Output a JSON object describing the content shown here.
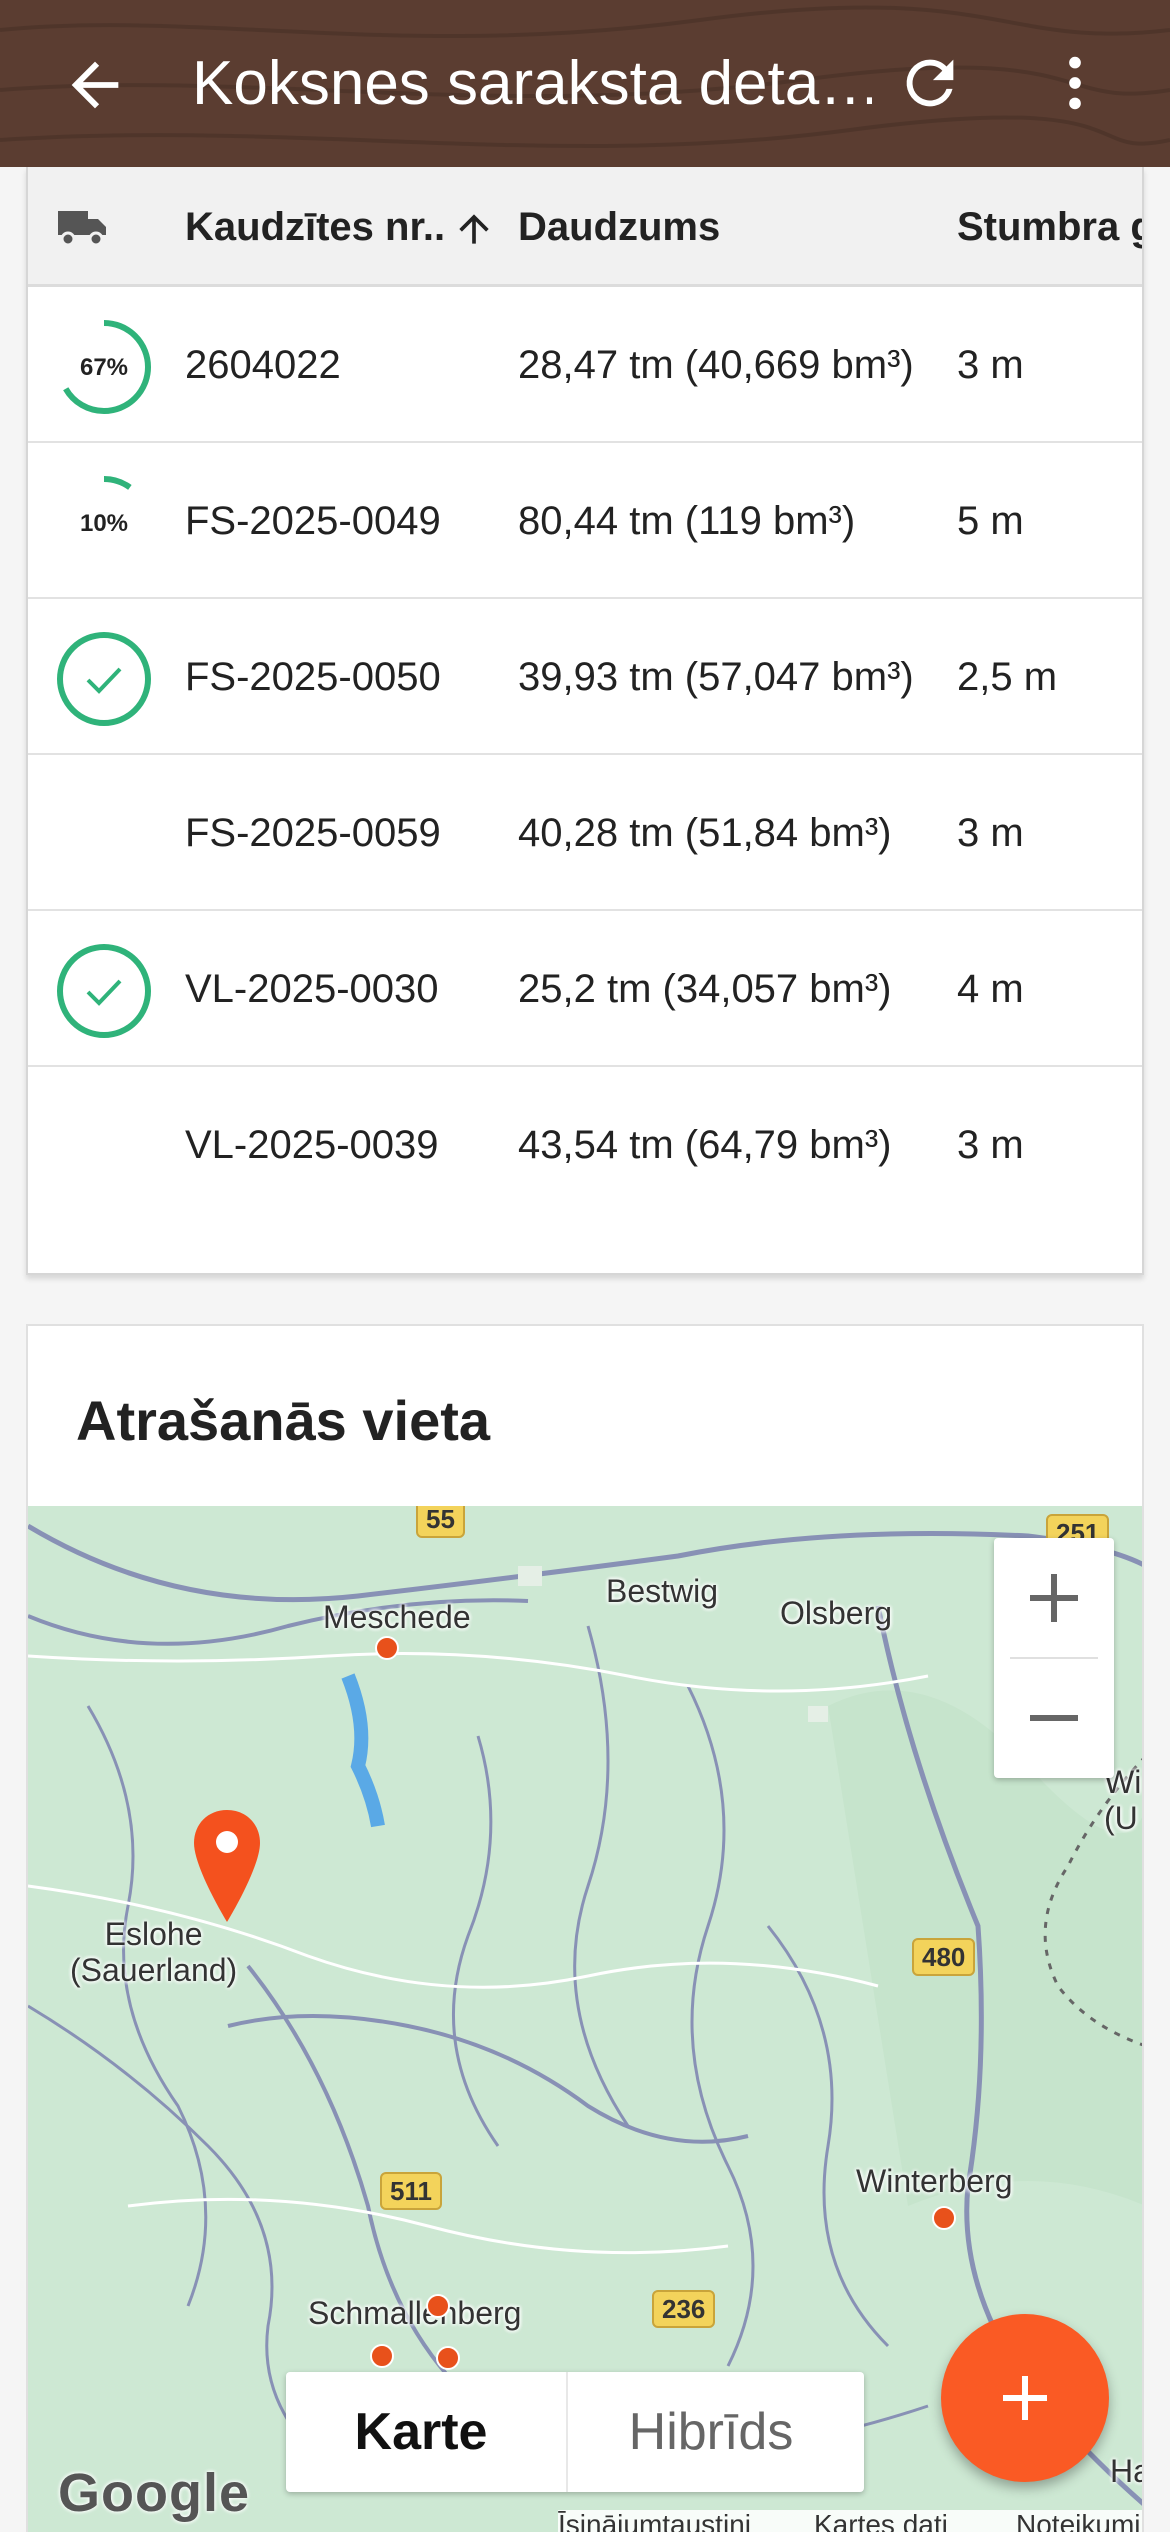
{
  "appbar": {
    "title": "Koksnes saraksta deta…",
    "icons": [
      "back-arrow-icon",
      "refresh-icon",
      "more-vert-icon"
    ],
    "background_color": "#5b3d31"
  },
  "table": {
    "headers": {
      "status_icon": "truck-icon",
      "pile_no": "Kaudzītes nr..",
      "sort_icon": "arrow-up-icon",
      "quantity": "Daudzums",
      "length": "Stumbra g"
    },
    "rows": [
      {
        "status": "progress",
        "progress_label": "67%",
        "progress": 0.67,
        "pile_no": "2604022",
        "quantity": "28,47 tm (40,669 bm³)",
        "length": "3 m"
      },
      {
        "status": "progress",
        "progress_label": "10%",
        "progress": 0.1,
        "pile_no": "FS-2025-0049",
        "quantity": "80,44 tm (119 bm³)",
        "length": "5 m"
      },
      {
        "status": "done",
        "pile_no": "FS-2025-0050",
        "quantity": "39,93 tm (57,047 bm³)",
        "length": "2,5 m"
      },
      {
        "status": "none",
        "pile_no": "FS-2025-0059",
        "quantity": "40,28 tm (51,84 bm³)",
        "length": "3 m"
      },
      {
        "status": "done",
        "pile_no": "VL-2025-0030",
        "quantity": "25,2 tm (34,057 bm³)",
        "length": "4 m"
      },
      {
        "status": "none",
        "pile_no": "VL-2025-0039",
        "quantity": "43,54 tm (64,79 bm³)",
        "length": "3 m"
      }
    ],
    "status_color": "#2fb37a"
  },
  "location": {
    "title": "Atrašanās vieta",
    "map": {
      "places": [
        "Meschede",
        "Bestwig",
        "Olsberg",
        "Eslohe\n(Sauerland)",
        "Winterberg",
        "Schmallenberg",
        "Wi\n(U",
        "Halle"
      ],
      "road_numbers": [
        "55",
        "251",
        "480",
        "511",
        "236"
      ],
      "zoom_in": "+",
      "zoom_out": "−",
      "map_types": {
        "map": "Karte",
        "hybrid": "Hibrīds"
      },
      "google_logo": "Google",
      "attribution": {
        "shortcuts": "Īsinājumtaustiņi",
        "map_data": "Kartes dati",
        "terms": "Noteikumi"
      },
      "marker_color": "#f4511e"
    }
  },
  "fab": {
    "icon": "plus-icon",
    "color": "#fa5a24"
  }
}
